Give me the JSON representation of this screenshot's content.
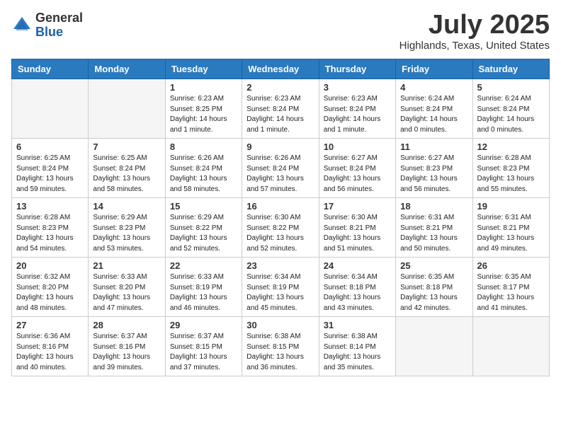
{
  "header": {
    "logo_general": "General",
    "logo_blue": "Blue",
    "month_title": "July 2025",
    "location": "Highlands, Texas, United States"
  },
  "days_of_week": [
    "Sunday",
    "Monday",
    "Tuesday",
    "Wednesday",
    "Thursday",
    "Friday",
    "Saturday"
  ],
  "weeks": [
    [
      {
        "day": "",
        "detail": ""
      },
      {
        "day": "",
        "detail": ""
      },
      {
        "day": "1",
        "detail": "Sunrise: 6:23 AM\nSunset: 8:25 PM\nDaylight: 14 hours and 1 minute."
      },
      {
        "day": "2",
        "detail": "Sunrise: 6:23 AM\nSunset: 8:24 PM\nDaylight: 14 hours and 1 minute."
      },
      {
        "day": "3",
        "detail": "Sunrise: 6:23 AM\nSunset: 8:24 PM\nDaylight: 14 hours and 1 minute."
      },
      {
        "day": "4",
        "detail": "Sunrise: 6:24 AM\nSunset: 8:24 PM\nDaylight: 14 hours and 0 minutes."
      },
      {
        "day": "5",
        "detail": "Sunrise: 6:24 AM\nSunset: 8:24 PM\nDaylight: 14 hours and 0 minutes."
      }
    ],
    [
      {
        "day": "6",
        "detail": "Sunrise: 6:25 AM\nSunset: 8:24 PM\nDaylight: 13 hours and 59 minutes."
      },
      {
        "day": "7",
        "detail": "Sunrise: 6:25 AM\nSunset: 8:24 PM\nDaylight: 13 hours and 58 minutes."
      },
      {
        "day": "8",
        "detail": "Sunrise: 6:26 AM\nSunset: 8:24 PM\nDaylight: 13 hours and 58 minutes."
      },
      {
        "day": "9",
        "detail": "Sunrise: 6:26 AM\nSunset: 8:24 PM\nDaylight: 13 hours and 57 minutes."
      },
      {
        "day": "10",
        "detail": "Sunrise: 6:27 AM\nSunset: 8:24 PM\nDaylight: 13 hours and 56 minutes."
      },
      {
        "day": "11",
        "detail": "Sunrise: 6:27 AM\nSunset: 8:23 PM\nDaylight: 13 hours and 56 minutes."
      },
      {
        "day": "12",
        "detail": "Sunrise: 6:28 AM\nSunset: 8:23 PM\nDaylight: 13 hours and 55 minutes."
      }
    ],
    [
      {
        "day": "13",
        "detail": "Sunrise: 6:28 AM\nSunset: 8:23 PM\nDaylight: 13 hours and 54 minutes."
      },
      {
        "day": "14",
        "detail": "Sunrise: 6:29 AM\nSunset: 8:23 PM\nDaylight: 13 hours and 53 minutes."
      },
      {
        "day": "15",
        "detail": "Sunrise: 6:29 AM\nSunset: 8:22 PM\nDaylight: 13 hours and 52 minutes."
      },
      {
        "day": "16",
        "detail": "Sunrise: 6:30 AM\nSunset: 8:22 PM\nDaylight: 13 hours and 52 minutes."
      },
      {
        "day": "17",
        "detail": "Sunrise: 6:30 AM\nSunset: 8:21 PM\nDaylight: 13 hours and 51 minutes."
      },
      {
        "day": "18",
        "detail": "Sunrise: 6:31 AM\nSunset: 8:21 PM\nDaylight: 13 hours and 50 minutes."
      },
      {
        "day": "19",
        "detail": "Sunrise: 6:31 AM\nSunset: 8:21 PM\nDaylight: 13 hours and 49 minutes."
      }
    ],
    [
      {
        "day": "20",
        "detail": "Sunrise: 6:32 AM\nSunset: 8:20 PM\nDaylight: 13 hours and 48 minutes."
      },
      {
        "day": "21",
        "detail": "Sunrise: 6:33 AM\nSunset: 8:20 PM\nDaylight: 13 hours and 47 minutes."
      },
      {
        "day": "22",
        "detail": "Sunrise: 6:33 AM\nSunset: 8:19 PM\nDaylight: 13 hours and 46 minutes."
      },
      {
        "day": "23",
        "detail": "Sunrise: 6:34 AM\nSunset: 8:19 PM\nDaylight: 13 hours and 45 minutes."
      },
      {
        "day": "24",
        "detail": "Sunrise: 6:34 AM\nSunset: 8:18 PM\nDaylight: 13 hours and 43 minutes."
      },
      {
        "day": "25",
        "detail": "Sunrise: 6:35 AM\nSunset: 8:18 PM\nDaylight: 13 hours and 42 minutes."
      },
      {
        "day": "26",
        "detail": "Sunrise: 6:35 AM\nSunset: 8:17 PM\nDaylight: 13 hours and 41 minutes."
      }
    ],
    [
      {
        "day": "27",
        "detail": "Sunrise: 6:36 AM\nSunset: 8:16 PM\nDaylight: 13 hours and 40 minutes."
      },
      {
        "day": "28",
        "detail": "Sunrise: 6:37 AM\nSunset: 8:16 PM\nDaylight: 13 hours and 39 minutes."
      },
      {
        "day": "29",
        "detail": "Sunrise: 6:37 AM\nSunset: 8:15 PM\nDaylight: 13 hours and 37 minutes."
      },
      {
        "day": "30",
        "detail": "Sunrise: 6:38 AM\nSunset: 8:15 PM\nDaylight: 13 hours and 36 minutes."
      },
      {
        "day": "31",
        "detail": "Sunrise: 6:38 AM\nSunset: 8:14 PM\nDaylight: 13 hours and 35 minutes."
      },
      {
        "day": "",
        "detail": ""
      },
      {
        "day": "",
        "detail": ""
      }
    ]
  ]
}
